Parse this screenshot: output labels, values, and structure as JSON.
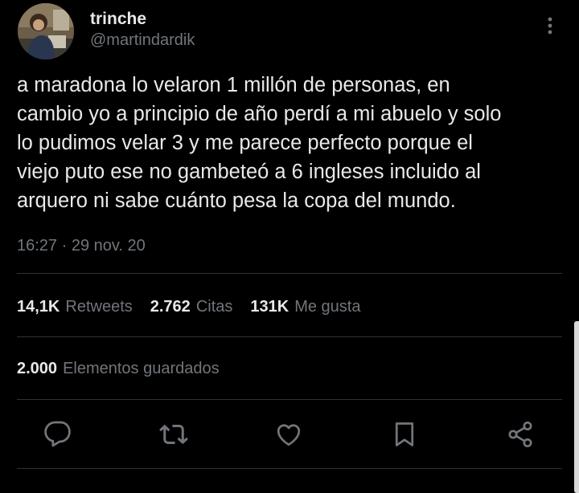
{
  "user": {
    "display_name": "trinche",
    "handle": "@martindardik",
    "avatar_icon": "user-photo-avatar"
  },
  "tweet": {
    "text": "a maradona lo velaron 1 millón de personas, en\ncambio yo a principio de año perdí a mi abuelo y solo\nlo pudimos velar 3 y me parece perfecto porque el\nviejo puto ese no gambeteó a 6 ingleses incluido al\narquero ni sabe cuánto pesa la copa del mundo.",
    "timestamp": "16:27 · 29 nov. 20"
  },
  "stats": {
    "retweets": {
      "count": "14,1K",
      "label": "Retweets"
    },
    "quotes": {
      "count": "2.762",
      "label": "Citas"
    },
    "likes": {
      "count": "131K",
      "label": "Me gusta"
    }
  },
  "saved": {
    "count": "2.000",
    "label": "Elementos guardados"
  },
  "actions": {
    "reply_icon": "reply-icon",
    "retweet_icon": "retweet-icon",
    "like_icon": "heart-icon",
    "bookmark_icon": "bookmark-icon",
    "share_icon": "share-icon"
  },
  "colors": {
    "background": "#000000",
    "primary_text": "#e7e9ea",
    "secondary_text": "#71767b",
    "divider": "#2f3336"
  }
}
